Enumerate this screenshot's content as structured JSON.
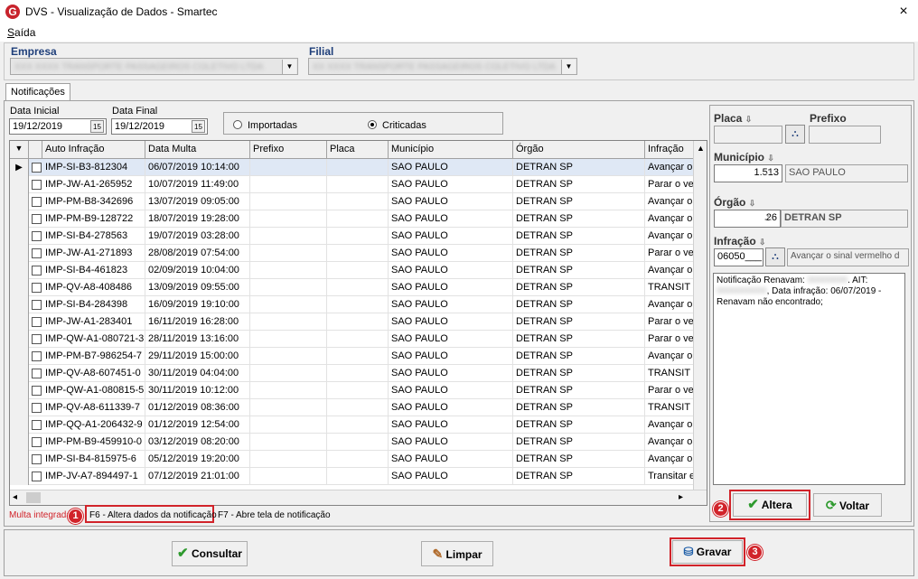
{
  "window": {
    "title": "DVS - Visualização de Dados - Smartec",
    "logo_letter": "G",
    "close": "×"
  },
  "menu": {
    "saida": "Saída"
  },
  "filters": {
    "empresa_label": "Empresa",
    "filial_label": "Filial"
  },
  "tabs": {
    "notificacoes": "Notificações"
  },
  "dates": {
    "inicial_label": "Data Inicial",
    "inicial_value": "19/12/2019",
    "final_label": "Data Final",
    "final_value": "19/12/2019",
    "cal_icon": "15"
  },
  "radio": {
    "importadas": "Importadas",
    "criticadas": "Criticadas",
    "selected": "criticadas"
  },
  "grid": {
    "columns": [
      "Auto Infração",
      "Data Multa",
      "Prefixo",
      "Placa",
      "Município",
      "Órgão",
      "Infração"
    ],
    "rows": [
      [
        "IMP-SI-B3-812304",
        "06/07/2019 10:14:00",
        "",
        "",
        "SAO PAULO",
        "DETRAN SP",
        "Avançar o"
      ],
      [
        "IMP-JW-A1-265952",
        "10/07/2019 11:49:00",
        "",
        "",
        "SAO PAULO",
        "DETRAN SP",
        "Parar o ve"
      ],
      [
        "IMP-PM-B8-342696",
        "13/07/2019 09:05:00",
        "",
        "",
        "SAO PAULO",
        "DETRAN SP",
        "Avançar o"
      ],
      [
        "IMP-PM-B9-128722",
        "18/07/2019 19:28:00",
        "",
        "",
        "SAO PAULO",
        "DETRAN SP",
        "Avançar o"
      ],
      [
        "IMP-SI-B4-278563",
        "19/07/2019 03:28:00",
        "",
        "",
        "SAO PAULO",
        "DETRAN SP",
        "Avançar o"
      ],
      [
        "IMP-JW-A1-271893",
        "28/08/2019 07:54:00",
        "",
        "",
        "SAO PAULO",
        "DETRAN SP",
        "Parar o ve"
      ],
      [
        "IMP-SI-B4-461823",
        "02/09/2019 10:04:00",
        "",
        "",
        "SAO PAULO",
        "DETRAN SP",
        "Avançar o"
      ],
      [
        "IMP-QV-A8-408486",
        "13/09/2019 09:55:00",
        "",
        "",
        "SAO PAULO",
        "DETRAN SP",
        "TRANSIT"
      ],
      [
        "IMP-SI-B4-284398",
        "16/09/2019 19:10:00",
        "",
        "",
        "SAO PAULO",
        "DETRAN SP",
        "Avançar o"
      ],
      [
        "IMP-JW-A1-283401",
        "16/11/2019 16:28:00",
        "",
        "",
        "SAO PAULO",
        "DETRAN SP",
        "Parar o ve"
      ],
      [
        "IMP-QW-A1-080721-3",
        "28/11/2019 13:16:00",
        "",
        "",
        "SAO PAULO",
        "DETRAN SP",
        "Parar o ve"
      ],
      [
        "IMP-PM-B7-986254-7",
        "29/11/2019 15:00:00",
        "",
        "",
        "SAO PAULO",
        "DETRAN SP",
        "Avançar o"
      ],
      [
        "IMP-QV-A8-607451-0",
        "30/11/2019 04:04:00",
        "",
        "",
        "SAO PAULO",
        "DETRAN SP",
        "TRANSIT"
      ],
      [
        "IMP-QW-A1-080815-5",
        "30/11/2019 10:12:00",
        "",
        "",
        "SAO PAULO",
        "DETRAN SP",
        "Parar o ve"
      ],
      [
        "IMP-QV-A8-611339-7",
        "01/12/2019 08:36:00",
        "",
        "",
        "SAO PAULO",
        "DETRAN SP",
        "TRANSIT"
      ],
      [
        "IMP-QQ-A1-206432-9",
        "01/12/2019 12:54:00",
        "",
        "",
        "SAO PAULO",
        "DETRAN SP",
        "Avançar o"
      ],
      [
        "IMP-PM-B9-459910-0",
        "03/12/2019 08:20:00",
        "",
        "",
        "SAO PAULO",
        "DETRAN SP",
        "Avançar o"
      ],
      [
        "IMP-SI-B4-815975-6",
        "05/12/2019 19:20:00",
        "",
        "",
        "SAO PAULO",
        "DETRAN SP",
        "Avançar o"
      ],
      [
        "IMP-JV-A7-894497-1",
        "07/12/2019 21:01:00",
        "",
        "",
        "SAO PAULO",
        "DETRAN SP",
        "Transitar e"
      ]
    ],
    "selected_row": 0
  },
  "status": {
    "multa_integrada": "Multa integrada",
    "f6": "F6 - Altera dados da notificação",
    "f7": "F7 - Abre tela de notificação"
  },
  "detail": {
    "placa_label": "Placa",
    "prefixo_label": "Prefixo",
    "municipio_label": "Município",
    "municipio_code": "1.513",
    "municipio_name": "SAO PAULO",
    "orgao_label": "Órgão",
    "orgao_code": "26",
    "orgao_name": "DETRAN SP",
    "infracao_label": "Infração",
    "infracao_code": "06050___",
    "infracao_desc": "Avançar o sinal vermelho d",
    "message_part1": "Notificação Renavam:",
    "message_part2": ". AIT:",
    "message_part3": ", Data infração: 06/07/2019 - Renavam  não encontrado;"
  },
  "buttons": {
    "altera": "Altera",
    "voltar": "Voltar",
    "consultar": "Consultar",
    "limpar": "Limpar",
    "gravar": "Gravar"
  },
  "badges": [
    "1",
    "2",
    "3"
  ],
  "colors": {
    "annotation_red": "#d1232a",
    "label_blue": "#1f3f7a",
    "check_green": "#2e9a2e"
  }
}
